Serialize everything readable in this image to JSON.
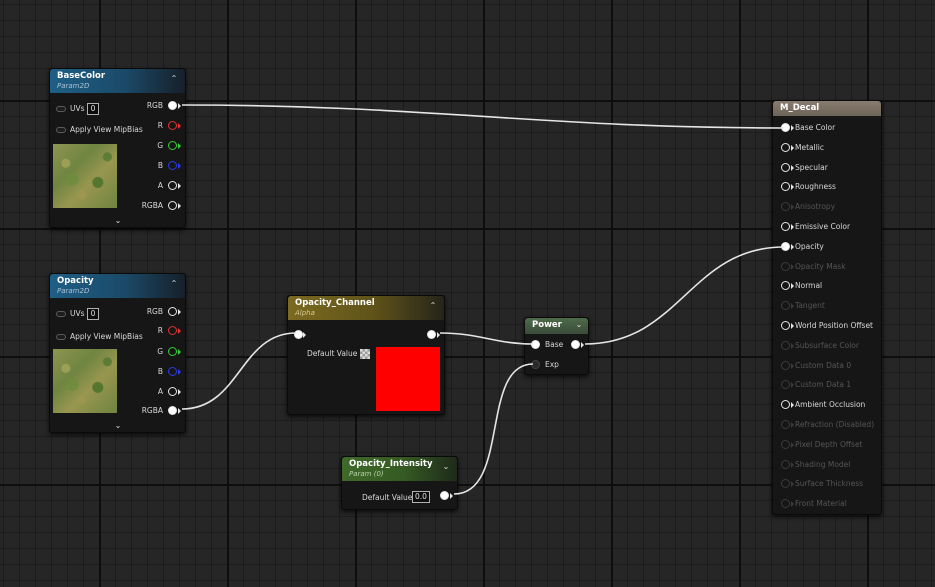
{
  "colors": {
    "wire": "#e6e6e6",
    "opacity_channel_default": "#ff0000",
    "pin_r": "#e23030",
    "pin_g": "#2fd02f",
    "pin_b": "#2d3be6"
  },
  "basecolor_node": {
    "title": "BaseColor",
    "subtitle": "Param2D",
    "uvs_label": "UVs",
    "uvs_value": "0",
    "mip_label": "Apply View MipBias",
    "outputs": [
      "RGB",
      "R",
      "G",
      "B",
      "A",
      "RGBA"
    ]
  },
  "opacity_node": {
    "title": "Opacity",
    "subtitle": "Param2D",
    "uvs_label": "UVs",
    "uvs_value": "0",
    "mip_label": "Apply View MipBias",
    "outputs": [
      "RGB",
      "R",
      "G",
      "B",
      "A",
      "RGBA"
    ]
  },
  "opacity_channel_node": {
    "title": "Opacity_Channel",
    "subtitle": "Alpha",
    "default_label": "Default Value"
  },
  "power_node": {
    "title": "Power",
    "base_label": "Base",
    "exp_label": "Exp"
  },
  "opacity_intensity_node": {
    "title": "Opacity_Intensity",
    "subtitle": "Param (0)",
    "default_label": "Default Value",
    "default_value": "0.0"
  },
  "decal_node": {
    "title": "M_Decal",
    "inputs": [
      {
        "label": "Base Color",
        "enabled": true,
        "connected": true
      },
      {
        "label": "Metallic",
        "enabled": true,
        "connected": false
      },
      {
        "label": "Specular",
        "enabled": true,
        "connected": false
      },
      {
        "label": "Roughness",
        "enabled": true,
        "connected": false
      },
      {
        "label": "Anisotropy",
        "enabled": false,
        "connected": false
      },
      {
        "label": "Emissive Color",
        "enabled": true,
        "connected": false
      },
      {
        "label": "Opacity",
        "enabled": true,
        "connected": true
      },
      {
        "label": "Opacity Mask",
        "enabled": false,
        "connected": false
      },
      {
        "label": "Normal",
        "enabled": true,
        "connected": false
      },
      {
        "label": "Tangent",
        "enabled": false,
        "connected": false
      },
      {
        "label": "World Position Offset",
        "enabled": true,
        "connected": false
      },
      {
        "label": "Subsurface Color",
        "enabled": false,
        "connected": false
      },
      {
        "label": "Custom Data 0",
        "enabled": false,
        "connected": false
      },
      {
        "label": "Custom Data 1",
        "enabled": false,
        "connected": false
      },
      {
        "label": "Ambient Occlusion",
        "enabled": true,
        "connected": false
      },
      {
        "label": "Refraction (Disabled)",
        "enabled": false,
        "connected": false
      },
      {
        "label": "Pixel Depth Offset",
        "enabled": false,
        "connected": false
      },
      {
        "label": "Shading Model",
        "enabled": false,
        "connected": false
      },
      {
        "label": "Surface Thickness",
        "enabled": false,
        "connected": false
      },
      {
        "label": "Front Material",
        "enabled": false,
        "connected": false
      }
    ]
  }
}
